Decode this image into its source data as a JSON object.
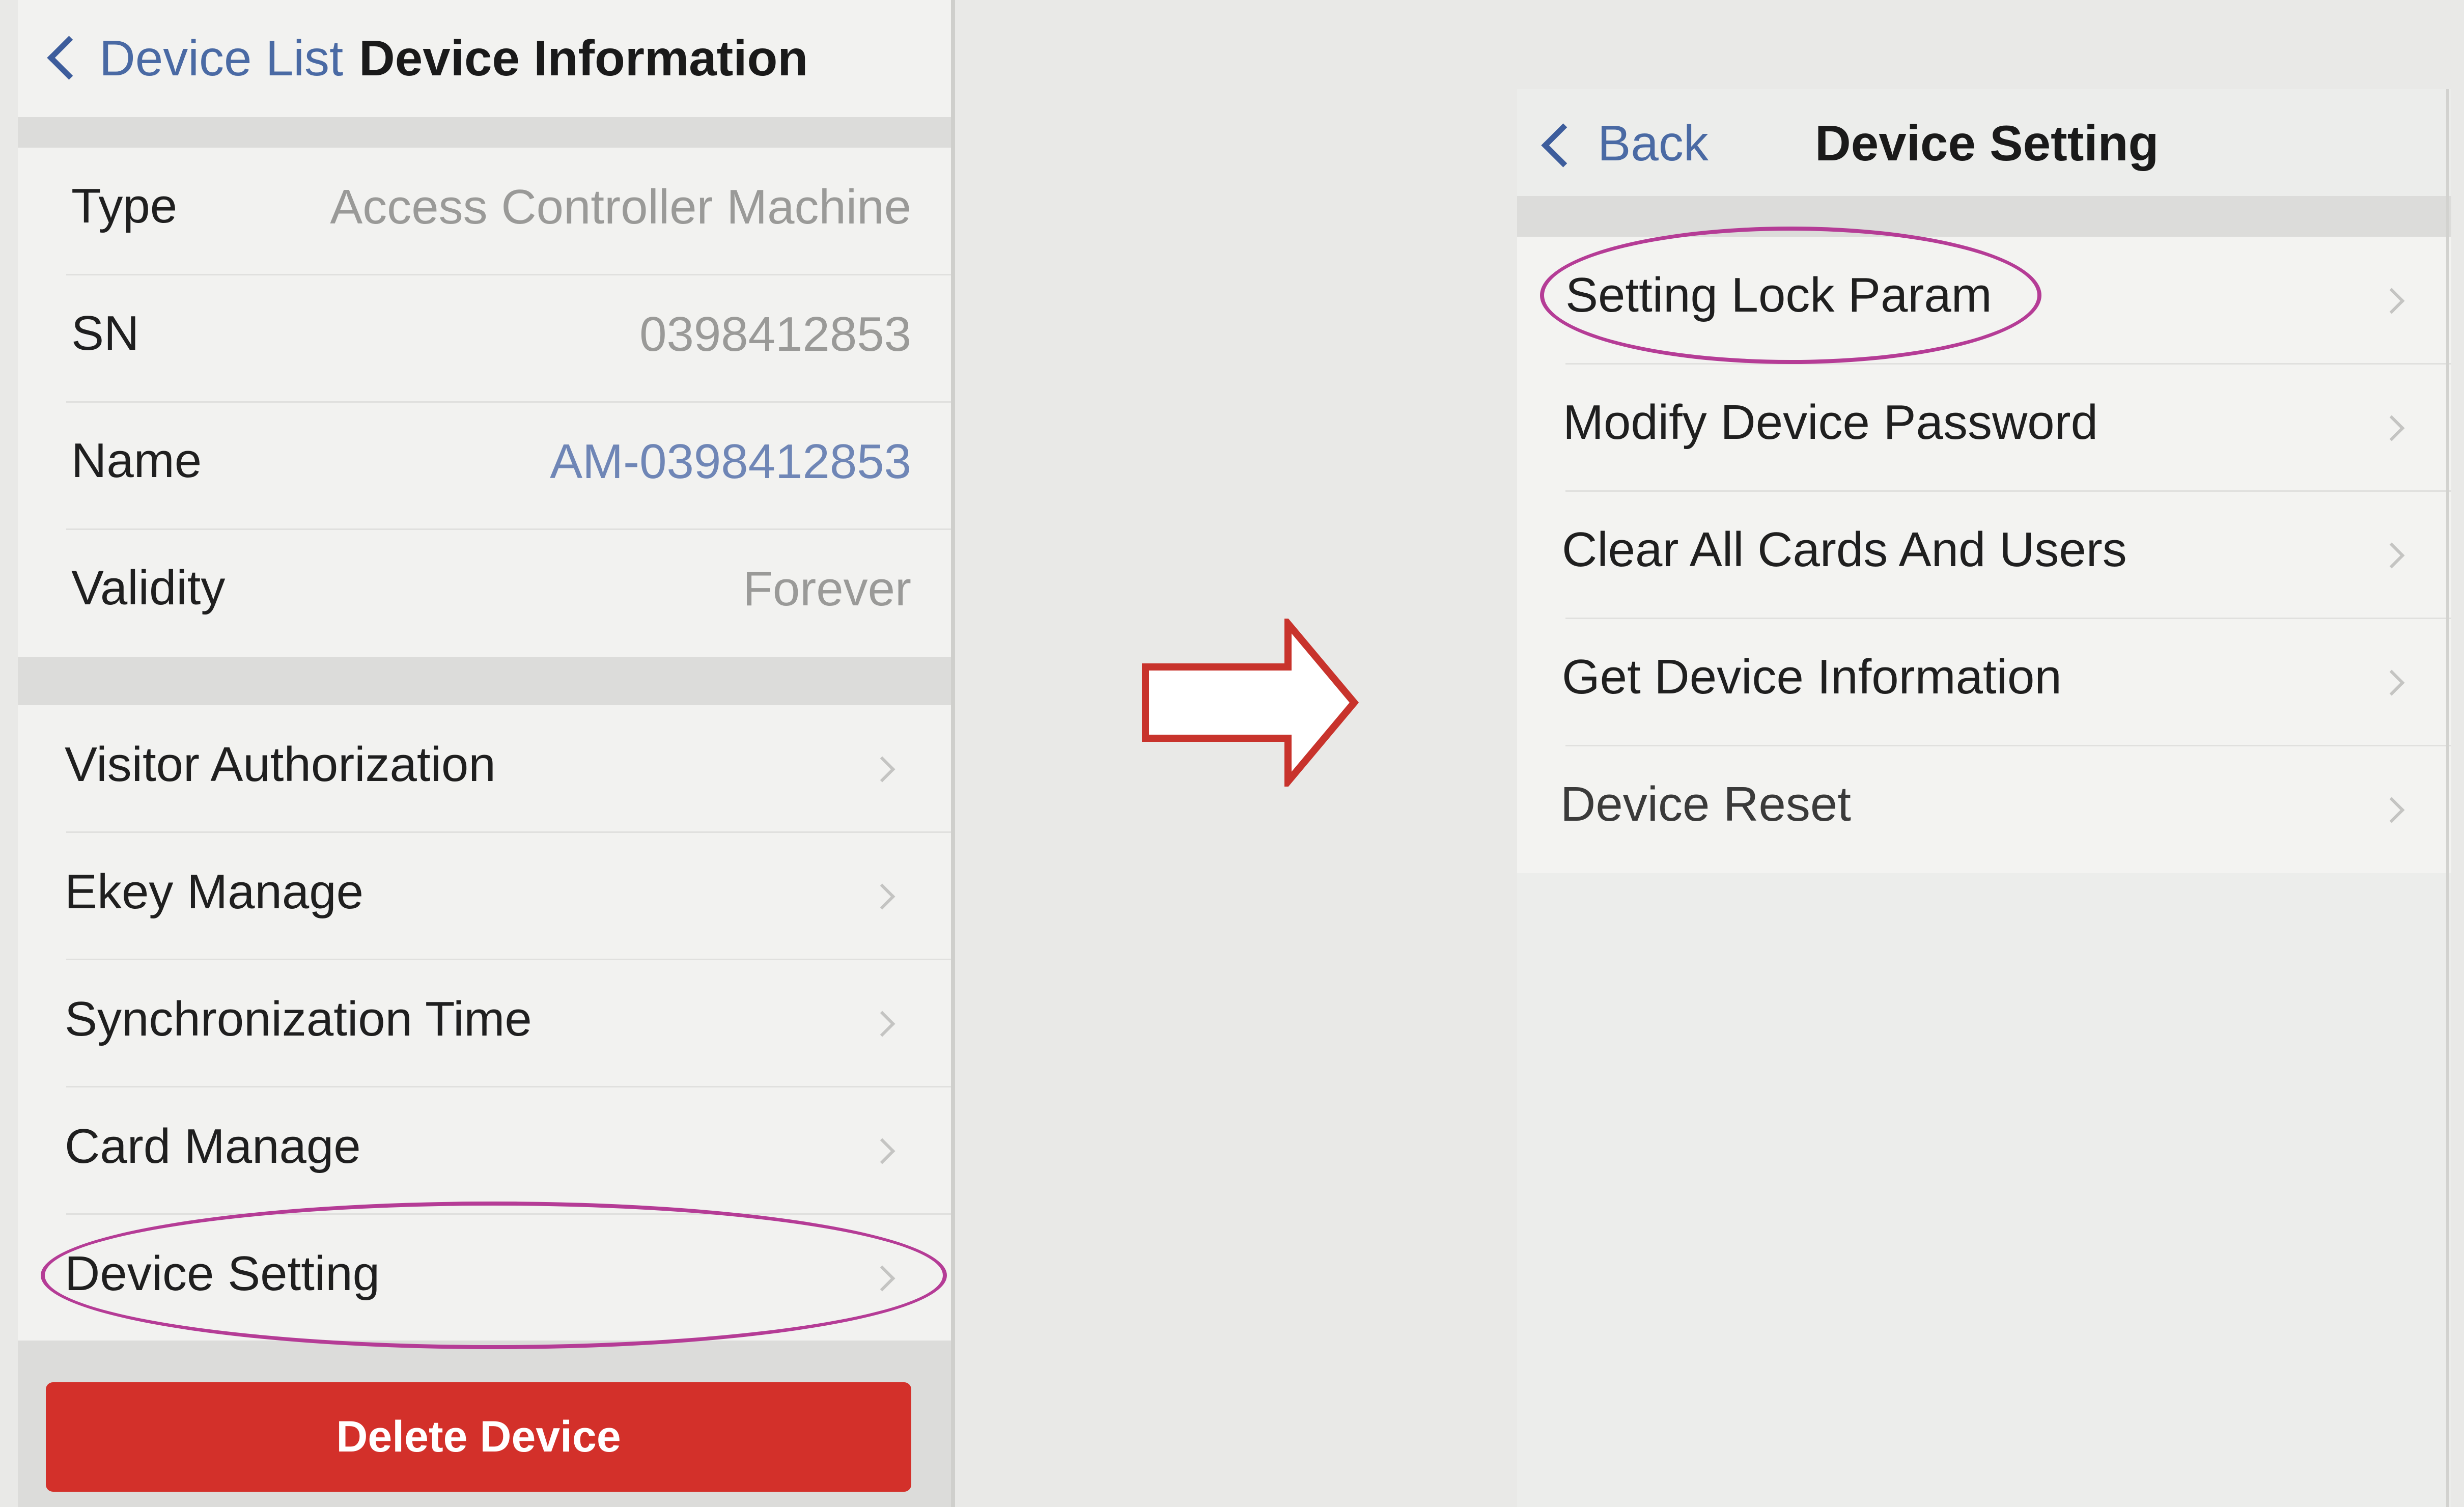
{
  "device_information": {
    "nav": {
      "back_label": "Device List",
      "title": "Device Information"
    },
    "info_rows": [
      {
        "label": "Type",
        "value": "Access Controller Machine"
      },
      {
        "label": "SN",
        "value": "0398412853"
      },
      {
        "label": "Name",
        "value": "AM-0398412853"
      },
      {
        "label": "Validity",
        "value": "Forever"
      }
    ],
    "menu_items": [
      {
        "label": "Visitor Authorization"
      },
      {
        "label": "Ekey Manage"
      },
      {
        "label": "Synchronization Time"
      },
      {
        "label": "Card Manage"
      },
      {
        "label": "Device Setting"
      }
    ],
    "delete_button_label": "Delete Device"
  },
  "device_setting": {
    "nav": {
      "back_label": "Back",
      "title": "Device Setting"
    },
    "menu_items": [
      {
        "label": "Setting Lock Param"
      },
      {
        "label": "Modify Device Password"
      },
      {
        "label": "Clear All Cards And Users"
      },
      {
        "label": "Get Device Information"
      },
      {
        "label": "Device Reset"
      }
    ]
  },
  "colors": {
    "accent_blue": "#3d5d9c",
    "delete_red": "#d3302a",
    "highlight_purple": "#b53c96",
    "arrow_red": "#c8332c"
  }
}
